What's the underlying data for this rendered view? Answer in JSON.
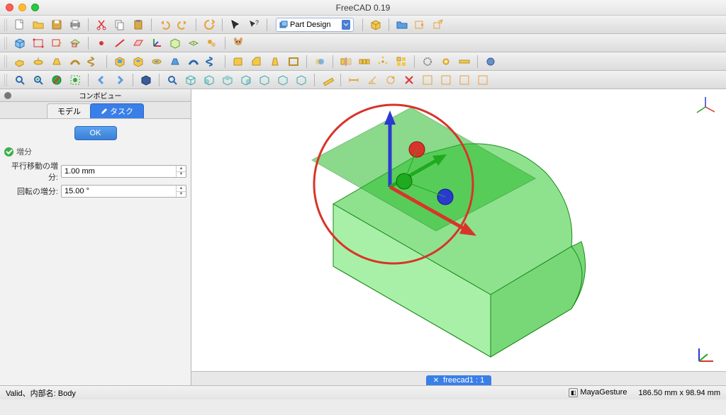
{
  "app": {
    "title": "FreeCAD 0.19"
  },
  "workbench": {
    "selected": "Part Design"
  },
  "combo": {
    "panel_title": "コンボビュー",
    "tab_model": "モデル",
    "tab_task": "タスク",
    "ok": "OK",
    "section": "増分",
    "translate_label": "平行移動の増分:",
    "translate_value": "1.00 mm",
    "rotate_label": "回転の増分:",
    "rotate_value": "15.00 °"
  },
  "doc_tab": {
    "label": "freecad1 : 1"
  },
  "status": {
    "left": "Valid、内部名: Body",
    "nav_style": "MayaGesture",
    "dims": "186.50 mm x 98.94 mm"
  },
  "icons": {
    "row1": [
      "new-file",
      "open-file",
      "save-file",
      "print",
      "cut",
      "copy",
      "paste",
      "undo",
      "redo",
      "refresh",
      "arrow-cursor",
      "whatsthis"
    ],
    "row1b": [
      "part-box",
      "nav-open",
      "nav-fwd",
      "nav-ext"
    ],
    "row2": [
      "body",
      "sketch",
      "edit-sketch",
      "map-sketch",
      "datum-point",
      "datum-line",
      "datum-plane",
      "datum-cs",
      "shape-binder",
      "sub-binder",
      "clone",
      "teddy"
    ],
    "row3": [
      "pad",
      "revolution",
      "loft",
      "sweep",
      "helix",
      "pocket",
      "hole",
      "groove",
      "sub-loft",
      "sub-sweep",
      "sub-helix",
      "fillet",
      "chamfer",
      "draft",
      "thickness",
      "boolean",
      "mirrored",
      "linear-pattern",
      "polar-pattern",
      "multi-transform",
      "scaled",
      "sprocket",
      "gear",
      "wizard",
      "sphere"
    ],
    "row4": [
      "fit-all",
      "fit-sel",
      "draw-style",
      "bbox",
      "arrow-left",
      "arrow-right",
      "view-cube",
      "zoom",
      "iso",
      "front",
      "top",
      "right",
      "rear",
      "bottom",
      "left",
      "measure",
      "m1",
      "m2",
      "m3",
      "m4",
      "m5",
      "m6",
      "m7",
      "m8"
    ]
  }
}
